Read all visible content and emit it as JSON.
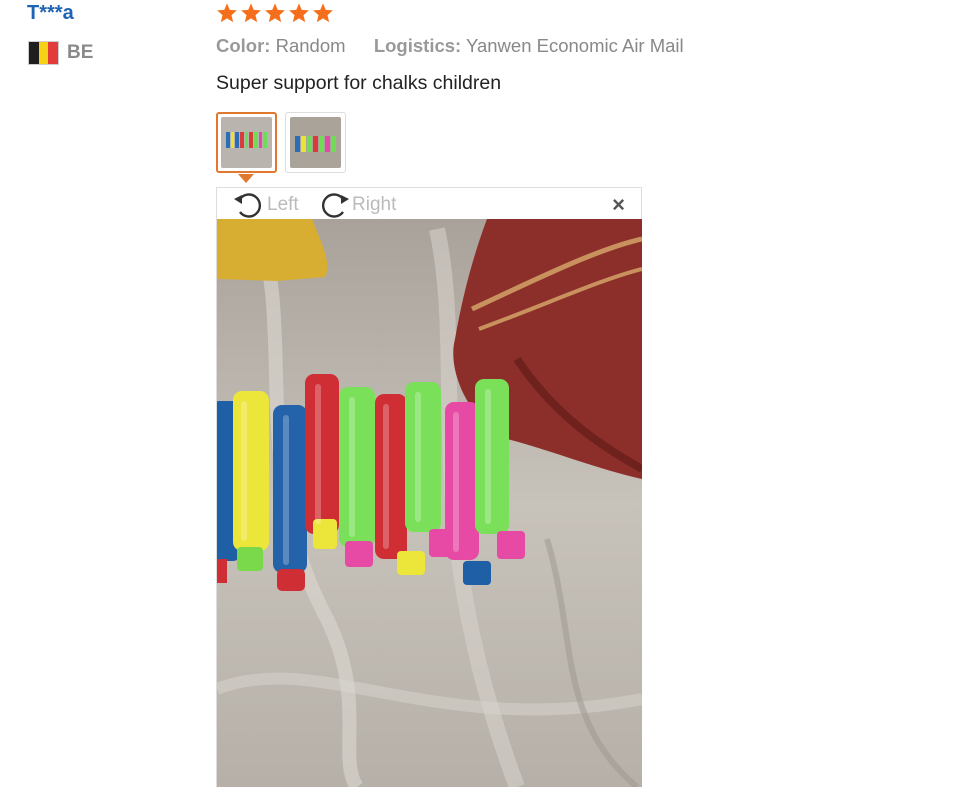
{
  "reviewer": {
    "name": "T***a",
    "country_code": "BE",
    "flag_colors": [
      "#1e1e1e",
      "#f7d117",
      "#e23b3b"
    ]
  },
  "rating": {
    "stars": 5,
    "max": 5,
    "color": "#f46e1b"
  },
  "attributes": [
    {
      "label": "Color:",
      "value": "Random"
    },
    {
      "label": "Logistics:",
      "value": "Yanwen Economic Air Mail"
    }
  ],
  "review_text": "Super support for chalks children",
  "thumbnails": [
    {
      "name": "thumbnail-1",
      "active": true
    },
    {
      "name": "thumbnail-2",
      "active": false
    }
  ],
  "viewer": {
    "rotate_left_label": "Left",
    "rotate_right_label": "Right",
    "close_label": "×"
  },
  "colors": {
    "accent": "#e0782e",
    "link": "#1f63b4"
  }
}
